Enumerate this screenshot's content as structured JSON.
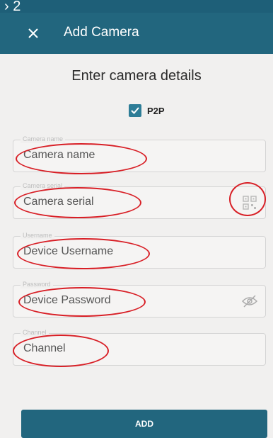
{
  "status_bar": {
    "text": "› 2"
  },
  "app_bar": {
    "title": "Add Camera",
    "close_icon": "close-icon"
  },
  "heading": "Enter camera details",
  "p2p": {
    "label": "P2P",
    "checked": true
  },
  "fields": [
    {
      "label": "Camera name",
      "value": "Camera name"
    },
    {
      "label": "Camera serial",
      "value": "Camera serial",
      "icon": "qr-code-icon"
    },
    {
      "label": "Username",
      "value": "Device Username"
    },
    {
      "label": "Password",
      "value": "Device Password",
      "icon": "eye-off-icon"
    },
    {
      "label": "Channel",
      "value": "Channel"
    }
  ],
  "add_button": {
    "label": "ADD"
  },
  "colors": {
    "app_bar": "#22667e",
    "highlight": "#d81f26",
    "checkbox": "#2d7d97"
  }
}
